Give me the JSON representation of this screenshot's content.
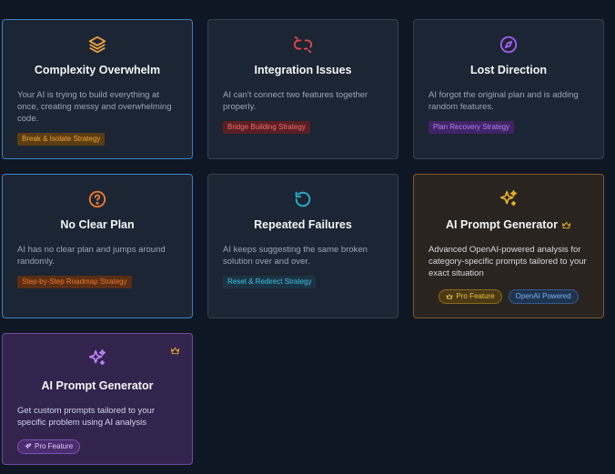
{
  "cards": [
    {
      "title": "Complexity Overwhelm",
      "description": "Your AI is trying to build everything at once, creating messy and overwhelming code.",
      "tag": "Break & Isolate Strategy",
      "icon": "layers-icon",
      "accent": "#f0a23b"
    },
    {
      "title": "Integration Issues",
      "description": "AI can't connect two features together properly.",
      "tag": "Bridge Building Strategy",
      "icon": "broken-link-icon",
      "accent": "#e04848"
    },
    {
      "title": "Lost Direction",
      "description": "AI forgot the original plan and is adding random features.",
      "tag": "Plan Recovery Strategy",
      "icon": "compass-icon",
      "accent": "#a45ef0"
    },
    {
      "title": "No Clear Plan",
      "description": "AI has no clear plan and jumps around randomly.",
      "tag": "Step-by-Step Roadmap Strategy",
      "icon": "question-circle-icon",
      "accent": "#f07a2a"
    },
    {
      "title": "Repeated Failures",
      "description": "AI keeps suggesting the same broken solution over and over.",
      "tag": "Reset & Redirect Strategy",
      "icon": "rotate-icon",
      "accent": "#22b6d6"
    },
    {
      "title": "AI Prompt Generator",
      "description": "Advanced OpenAI-powered analysis for category-specific prompts tailored to your exact situation",
      "pro_badge": "Pro Feature",
      "openai_badge": "OpenAI Powered",
      "icon": "sparkles-icon",
      "accent": "#f0b429"
    },
    {
      "title": "AI Prompt Generator",
      "description": "Get custom prompts tailored to your specific problem using AI analysis",
      "pro_badge": "Pro Feature",
      "icon": "sparkles-icon",
      "accent": "#c084fc"
    }
  ]
}
